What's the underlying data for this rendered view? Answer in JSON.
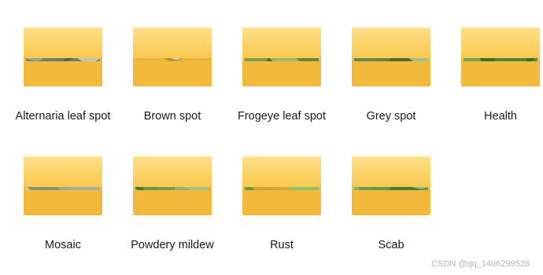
{
  "folders": [
    {
      "label": "Alternaria leaf spot",
      "thumb": "alternaria",
      "thumb_colors": [
        "#6b7f73",
        "#9aa9a0",
        "#4f5f52",
        "#c8cfc8"
      ]
    },
    {
      "label": "Brown spot",
      "thumb": "brown",
      "thumb_colors": [
        "#e6e6e6",
        "#e0b22a",
        "#b58a1b",
        "#d9d9d9"
      ]
    },
    {
      "label": "Frogeye leaf spot",
      "thumb": "frogeye",
      "thumb_colors": [
        "#7ea35a",
        "#3e6b2e",
        "#9dbb7a",
        "#5a8a3c"
      ]
    },
    {
      "label": "Grey spot",
      "thumb": "grey",
      "thumb_colors": [
        "#5e8a53",
        "#8fb07e",
        "#3f6a39",
        "#a9c29b"
      ]
    },
    {
      "label": "Health",
      "thumb": "health",
      "thumb_colors": [
        "#4f8a3f",
        "#70a85a",
        "#2f6b2a",
        "#8cbf70"
      ]
    },
    {
      "label": "Mosaic",
      "thumb": "mosaic",
      "thumb_colors": [
        "#c9d0cc",
        "#5a6a4f",
        "#7d8a6d",
        "#a0aaa0"
      ]
    },
    {
      "label": "Powdery mildew",
      "thumb": "powdery",
      "thumb_colors": [
        "#6e9a57",
        "#3f7034",
        "#94b87c",
        "#a6c58f"
      ]
    },
    {
      "label": "Rust",
      "thumb": "rust",
      "thumb_colors": [
        "#8fc06a",
        "#5e9a43",
        "#d8a43b",
        "#b3d48f"
      ]
    },
    {
      "label": "Scab",
      "thumb": "scab",
      "thumb_colors": [
        "#5f9a4f",
        "#87b86d",
        "#3e7a35",
        "#a3c98c"
      ]
    }
  ],
  "watermark": "CSDN @qq_1406299528",
  "colors": {
    "folder_back": "#f2b93b",
    "folder_front_top": "#ffe08a",
    "folder_front_bottom": "#fbc94e",
    "folder_edge": "#e8a92a"
  }
}
